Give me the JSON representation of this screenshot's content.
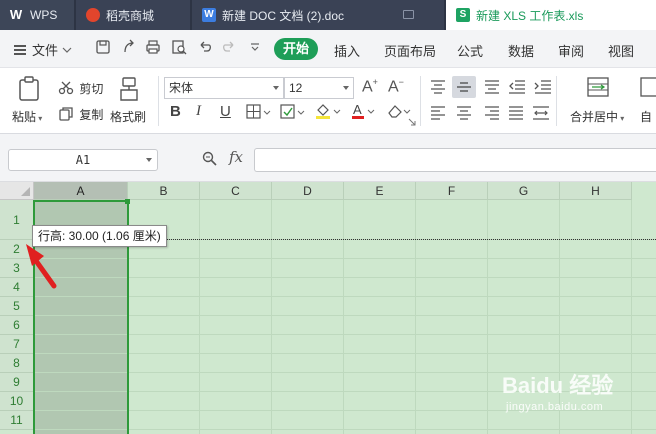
{
  "tabs": {
    "wps": "WPS",
    "shop": "稻壳商城",
    "doc": "新建 DOC 文档 (2).doc",
    "xls": "新建 XLS 工作表.xls"
  },
  "menu": {
    "file": "文件",
    "start": "开始",
    "insert": "插入",
    "page_layout": "页面布局",
    "formula": "公式",
    "data": "数据",
    "review": "审阅",
    "view": "视图"
  },
  "ribbon": {
    "paste": "粘贴",
    "cut": "剪切",
    "copy": "复制",
    "format_painter": "格式刷",
    "font_name": "宋体",
    "font_size": "12",
    "merge_center": "合并居中",
    "auto_wrap_partial": "自"
  },
  "formula_bar": {
    "name_box": "A1",
    "fx": "fx",
    "formula": ""
  },
  "grid": {
    "columns": [
      "A",
      "B",
      "C",
      "D",
      "E",
      "F",
      "G",
      "H"
    ],
    "rows": [
      "1",
      "2",
      "3",
      "4",
      "5",
      "6",
      "7",
      "8",
      "9",
      "10",
      "11"
    ],
    "selected_column": "A"
  },
  "tooltip": {
    "row_height": "行高: 30.00 (1.06 厘米)"
  },
  "watermark": {
    "main": "Baidu 经验",
    "sub": "jingyan.baidu.com"
  },
  "colors": {
    "tab_bar": "#2d3444",
    "accent_green": "#1e9e58",
    "grid_bg": "#cfe8cf",
    "selection_border": "#2e9a3a",
    "arrow_red": "#e02020"
  },
  "icons": {
    "save": "save-icon",
    "print": "print-icon",
    "undo": "undo-icon",
    "redo": "redo-icon",
    "paste": "clipboard-icon",
    "cut": "scissors-icon",
    "copy": "copy-icon",
    "format_painter": "brush-icon",
    "zoom": "magnifier-icon"
  }
}
